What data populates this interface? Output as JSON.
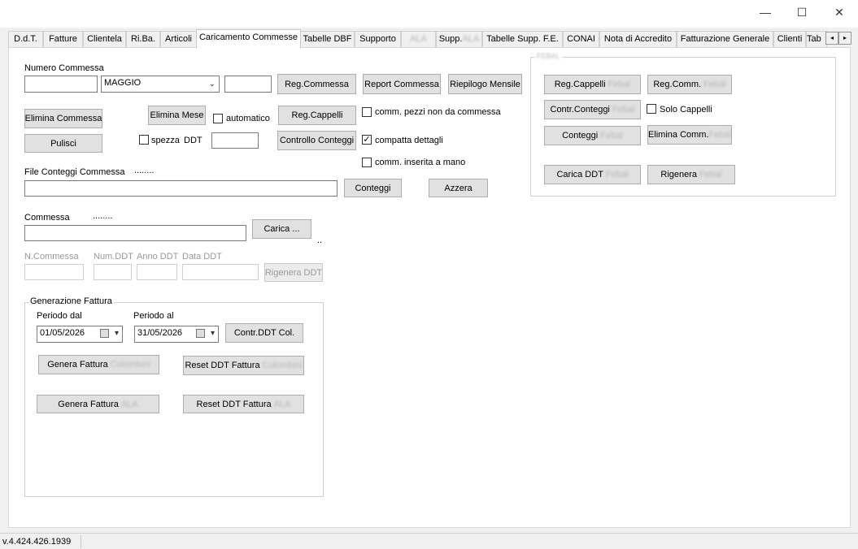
{
  "window": {
    "title": "",
    "min_glyph": "—",
    "max_glyph": "☐",
    "close_glyph": "✕"
  },
  "tabs": [
    {
      "label": "D.d.T."
    },
    {
      "label": "Fatture"
    },
    {
      "label": "Clientela"
    },
    {
      "label": "Ri.Ba."
    },
    {
      "label": "Articoli"
    },
    {
      "label": "Caricamento Commesse",
      "active": true
    },
    {
      "label": "Tabelle DBF"
    },
    {
      "label": "Supporto"
    },
    {
      "label": "ALA"
    },
    {
      "label": "Supp.",
      "suffix": "ALA"
    },
    {
      "label": "Tabelle Supp. F.E."
    },
    {
      "label": "CONAI"
    },
    {
      "label": "Nota di Accredito"
    },
    {
      "label": "Fatturazione Generale"
    },
    {
      "label": "Clienti"
    },
    {
      "label": "Tab"
    }
  ],
  "tab_scroll": {
    "left": "◂",
    "right": "▸"
  },
  "commessa": {
    "numero_label": "Numero Commessa",
    "numero_value": "",
    "mese_value": "MAGGIO",
    "anno_value": "",
    "reg_commessa": "Reg.Commessa",
    "report_commessa": "Report Commessa",
    "riepilogo_mensile": "Riepilogo Mensile",
    "elimina_commessa": "Elimina Commessa",
    "elimina_mese": "Elimina Mese",
    "automatico": "automatico",
    "reg_cappelli": "Reg.Cappelli",
    "comm_pezzi": "comm. pezzi non da commessa",
    "pulisci": "Pulisci",
    "spezza": "spezza",
    "ddt": "DDT",
    "spezza_value": "",
    "controllo_conteggi": "Controllo Conteggi",
    "compatta_dettagli": "compatta dettagli",
    "comm_inserita": "comm. inserita a mano",
    "check_mark": "✓"
  },
  "file_conteggi": {
    "label": "File Conteggi Commessa",
    "dots": "........",
    "value": "",
    "conteggi": "Conteggi",
    "azzera": "Azzera"
  },
  "commessa_file": {
    "label": "Commessa",
    "dots": "........",
    "value": "",
    "carica": "Carica ...",
    "trailing": ".."
  },
  "ddt_regen": {
    "n_commessa": "N.Commessa",
    "num_ddt": "Num.DDT",
    "anno_ddt": "Anno DDT",
    "data_ddt": "Data DDT",
    "rigenera": "Rigenera DDT"
  },
  "fattura": {
    "group_title": "Generazione Fattura",
    "periodo_dal": "Periodo dal",
    "periodo_al": "Periodo al",
    "date_from": "01/05/2026",
    "date_to": "31/05/2026",
    "contr_ddt": "Contr.DDT Col.",
    "genera_col": "Genera Fattura",
    "genera_col_suffix": "Colombini",
    "reset_col": "Reset DDT Fattura",
    "reset_col_suffix": "Colombini",
    "genera_ala": "Genera Fattura",
    "genera_ala_suffix": "ALA",
    "reset_ala": "Reset DDT Fattura",
    "reset_ala_suffix": "ALA"
  },
  "febal": {
    "group_title": "FEBAL",
    "reg_cappelli": "Reg.Cappelli",
    "reg_comm": "Reg.Comm.",
    "contr_conteggi": "Contr.Conteggi",
    "solo_cappelli": "Solo Cappelli",
    "conteggi": "Conteggi",
    "elimina_comm": "Elimina Comm.",
    "carica_ddt": "Carica DDT",
    "rigenera": "Rigenera",
    "suffix": "Febal"
  },
  "status": {
    "version": "v.4.424.426.1939"
  }
}
